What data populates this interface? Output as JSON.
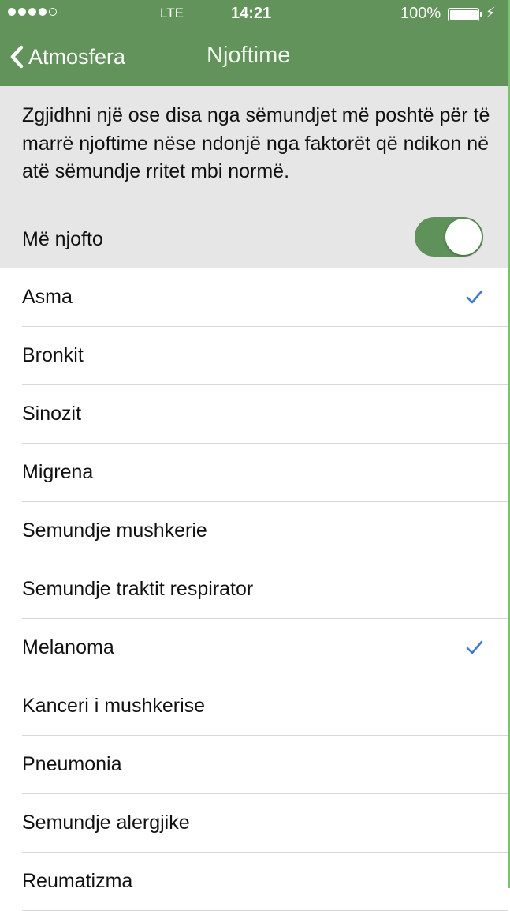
{
  "status_bar": {
    "carrier": "LTE",
    "time": "14:21",
    "battery": "100%",
    "signal_bars_filled": 4,
    "signal_bars_total": 5
  },
  "nav": {
    "back_label": "Atmosfera",
    "title": "Njoftime"
  },
  "info": {
    "description": "Zgjidhni një ose disa nga sëmundjet më poshtë për të marrë njoftime nëse ndonjë nga faktorët që ndikon në atë sëmundje rritet mbi normë.",
    "notify_label": "Më njofto",
    "notify_enabled": true
  },
  "colors": {
    "accent": "#62935a",
    "check": "#3b7bd6"
  },
  "diseases": [
    {
      "label": "Asma",
      "checked": true
    },
    {
      "label": "Bronkit",
      "checked": false
    },
    {
      "label": "Sinozit",
      "checked": false
    },
    {
      "label": "Migrena",
      "checked": false
    },
    {
      "label": "Semundje mushkerie",
      "checked": false
    },
    {
      "label": "Semundje traktit respirator",
      "checked": false
    },
    {
      "label": "Melanoma",
      "checked": true
    },
    {
      "label": "Kanceri i mushkerise",
      "checked": false
    },
    {
      "label": "Pneumonia",
      "checked": false
    },
    {
      "label": "Semundje alergjike",
      "checked": false
    },
    {
      "label": "Reumatizma",
      "checked": false
    }
  ]
}
